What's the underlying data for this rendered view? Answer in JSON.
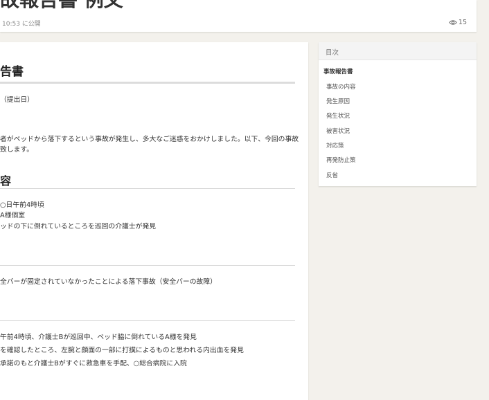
{
  "header": {
    "title_fragment": "故報告書 例文",
    "published": "10:53 に公開",
    "views": "15"
  },
  "article": {
    "heading1": "告書",
    "date_line": "（提出日）",
    "intro_1": "者がベッドから落下するという事故が発生し、多大なご迷惑をおかけしました。以下、今回の事故",
    "intro_2": "致します。",
    "section_content_title": "容",
    "content_line_1": "○日午前4時頃",
    "content_line_2": "A様個室",
    "content_line_3": "ッドの下に倒れているところを巡回の介護士が発見",
    "cause_line_1": "全バーが固定されていなかったことによる落下事故（安全バーの故障）",
    "situation_line_1": "午前4時頃、介護士Bが巡回中、ベッド脇に倒れているA様を発見",
    "situation_line_2": "を確認したところ、左腕と顔面の一部に打撲によるものと思われる内出血を発見",
    "situation_line_3": "承諾のもと介護士Bがすぐに救急車を手配、○総合病院に入院"
  },
  "toc": {
    "title": "目次",
    "items": [
      {
        "label": "事故報告書",
        "level": 1
      },
      {
        "label": "事故の内容",
        "level": 2
      },
      {
        "label": "発生原因",
        "level": 2
      },
      {
        "label": "発生状況",
        "level": 2
      },
      {
        "label": "被害状況",
        "level": 2
      },
      {
        "label": "対応策",
        "level": 2
      },
      {
        "label": "再発防止策",
        "level": 2
      },
      {
        "label": "反省",
        "level": 2
      }
    ]
  },
  "colors": {
    "background": "#f3f1ec",
    "card": "#ffffff",
    "text": "#333333",
    "muted": "#888888"
  }
}
